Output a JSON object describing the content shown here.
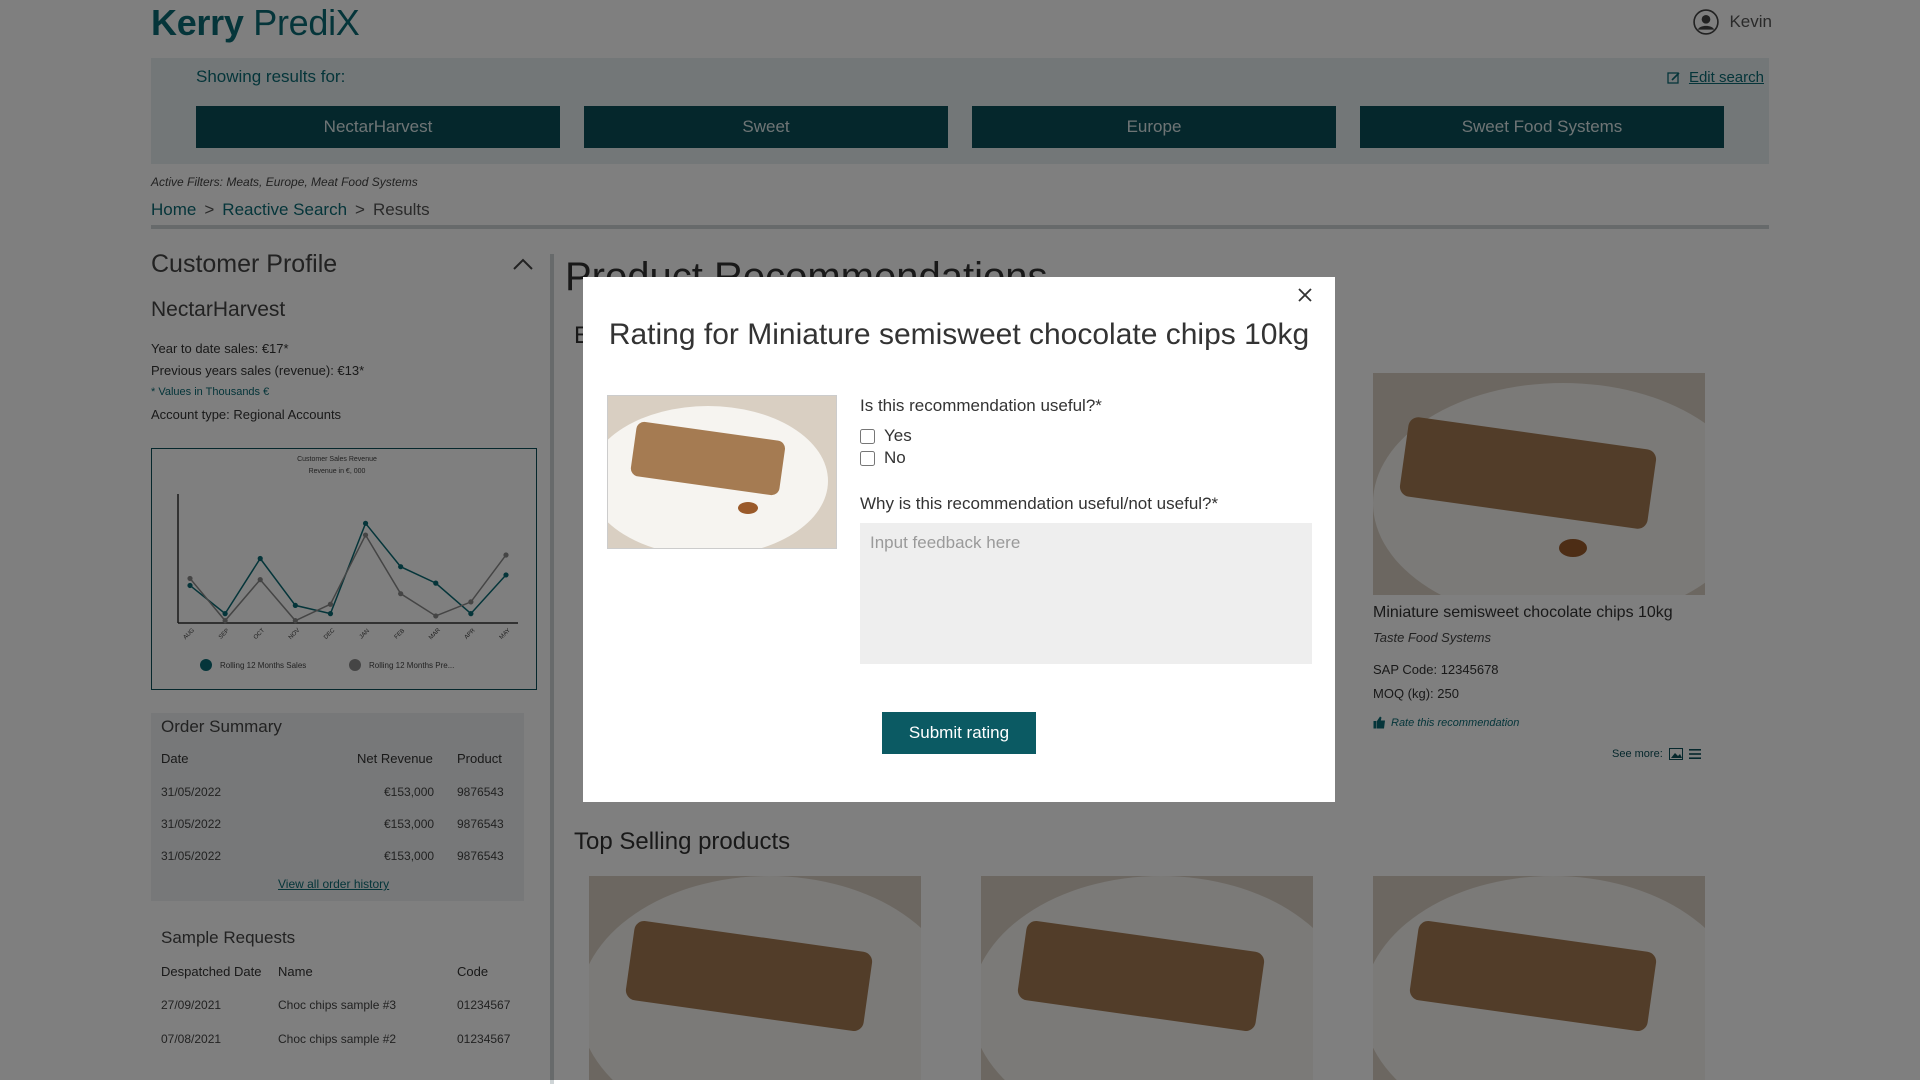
{
  "app": {
    "logo_bold": "Kerry",
    "logo_light": "PrediX",
    "user_name": "Kevin"
  },
  "search": {
    "showing_label": "Showing results for:",
    "edit_label": "Edit search",
    "chips": [
      "NectarHarvest",
      "Sweet",
      "Europe",
      "Sweet Food Systems"
    ],
    "active_filters": "Active Filters: Meats, Europe, Meat Food Systems"
  },
  "breadcrumb": {
    "home": "Home",
    "sep": ">",
    "reactive": "Reactive Search",
    "current": "Results"
  },
  "profile": {
    "title": "Customer Profile",
    "name": "NectarHarvest",
    "ytd": "Year to date sales: €17*",
    "prev": "Previous years sales (revenue): €13*",
    "note": "* Values in Thousands €",
    "account_type": "Account type: Regional Accounts"
  },
  "chart_data": {
    "type": "line",
    "title": "Customer Sales Revenue",
    "subtitle": "Revenue in €, 000",
    "categories": [
      "AUG",
      "SEP",
      "OCT",
      "NOV",
      "DEC",
      "JAN",
      "FEB",
      "MAR",
      "APR",
      "MAY"
    ],
    "series": [
      {
        "name": "Rolling 12 Months Sales",
        "color": "#0b6b74",
        "values": [
          3.2,
          0.8,
          5.5,
          1.5,
          0.8,
          8.5,
          4.8,
          3.4,
          0.8,
          4.1
        ]
      },
      {
        "name": "Rolling 12 Months Pre...",
        "color": "#8a8a8a",
        "values": [
          3.8,
          0.2,
          3.7,
          0.2,
          1.6,
          7.5,
          2.5,
          0.6,
          1.8,
          5.8
        ]
      }
    ],
    "ylim": [
      0,
      11
    ],
    "legend": "bottom"
  },
  "orders": {
    "title": "Order Summary",
    "headers": [
      "Date",
      "Net Revenue",
      "Product"
    ],
    "rows": [
      [
        "31/05/2022",
        "€153,000",
        "9876543"
      ],
      [
        "31/05/2022",
        "€153,000",
        "9876543"
      ],
      [
        "31/05/2022",
        "€153,000",
        "9876543"
      ]
    ],
    "link": "View all order history"
  },
  "samples": {
    "title": "Sample Requests",
    "headers": [
      "Despatched Date",
      "Name",
      "Code"
    ],
    "rows": [
      [
        "27/09/2021",
        "Choc chips sample #3",
        "01234567"
      ],
      [
        "07/08/2021",
        "Choc chips sample #2",
        "01234567"
      ]
    ]
  },
  "main": {
    "title": "Product Recommendations",
    "sub": "E",
    "card": {
      "name": "Miniature semisweet chocolate chips 10kg",
      "supplier": "Taste Food Systems",
      "sap": "SAP Code: 12345678",
      "moq": "MOQ (kg): 250",
      "rate": "Rate this recommendation",
      "see_more": "See more:"
    },
    "top_selling": "Top Selling products"
  },
  "modal": {
    "title": "Rating for Miniature semisweet chocolate chips 10kg",
    "q1": "Is this recommendation useful?*",
    "yes": "Yes",
    "no": "No",
    "q2": "Why is this recommendation useful/not  useful?*",
    "placeholder": "Input feedback here",
    "submit": "Submit rating"
  }
}
